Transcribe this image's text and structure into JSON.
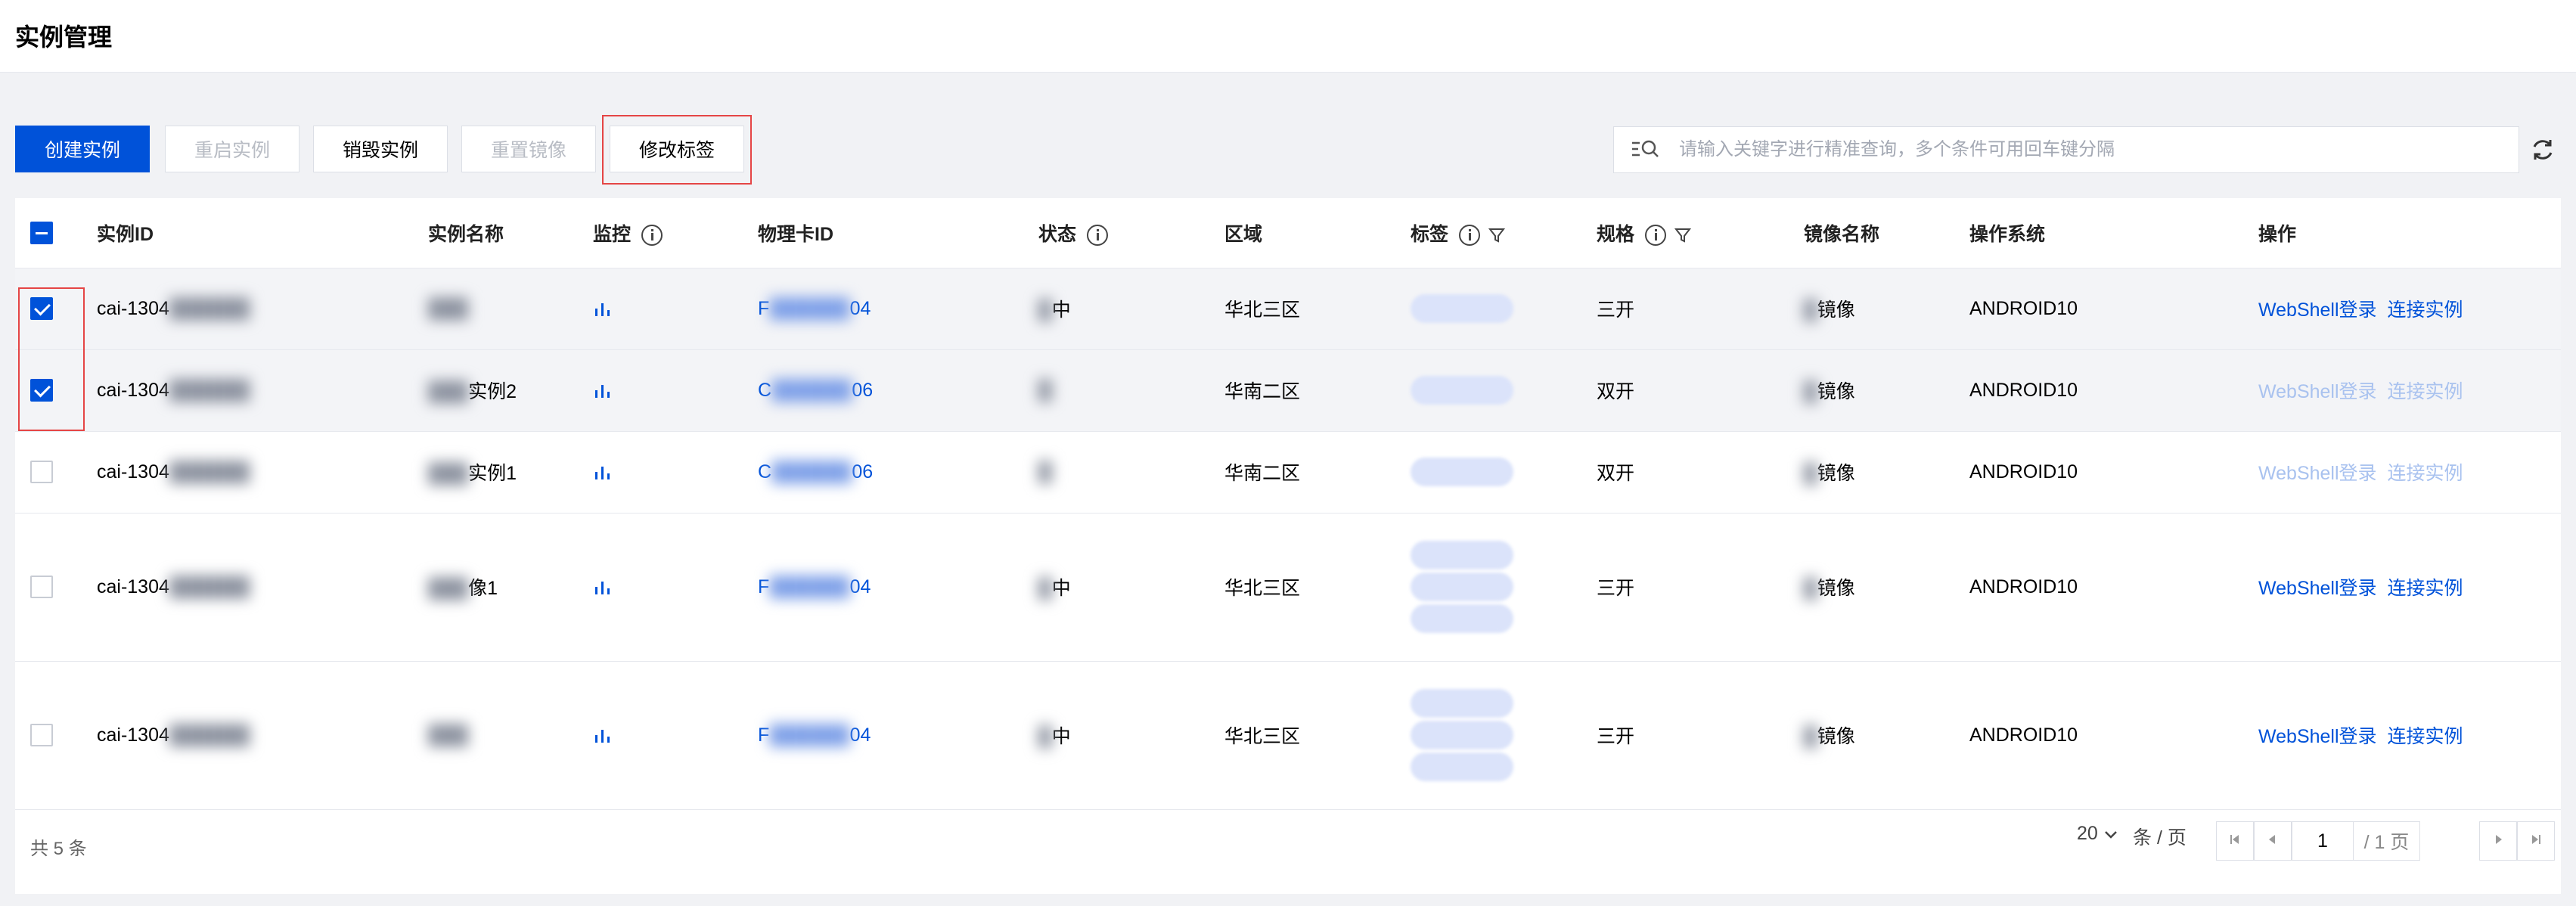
{
  "page": {
    "title": "实例管理"
  },
  "toolbar": {
    "create": "创建实例",
    "restart": "重启实例",
    "destroy": "销毁实例",
    "reset_image": "重置镜像",
    "modify_tags": "修改标签"
  },
  "search": {
    "placeholder": "请输入关键字进行精准查询，多个条件可用回车键分隔"
  },
  "table": {
    "headers": {
      "instance_id": "实例ID",
      "instance_name": "实例名称",
      "monitor": "监控",
      "card_id": "物理卡ID",
      "status": "状态",
      "region": "区域",
      "tags": "标签",
      "spec": "规格",
      "image_name": "镜像名称",
      "os": "操作系统",
      "actions": "操作"
    },
    "rows": [
      {
        "checked": true,
        "id": "cai-1304",
        "name": "",
        "card": "F",
        "card_tail": "04",
        "status": "中",
        "region": "华北三区",
        "spec": "三开",
        "image": "镜像",
        "os": "ANDROID10",
        "webshell": "WebShell登录",
        "connect": "连接实例",
        "enabled": true
      },
      {
        "checked": true,
        "id": "cai-1304",
        "name": "实例2",
        "card": "C",
        "card_tail": "06",
        "status": "",
        "region": "华南二区",
        "spec": "双开",
        "image": "镜像",
        "os": "ANDROID10",
        "webshell": "WebShell登录",
        "connect": "连接实例",
        "enabled": false
      },
      {
        "checked": false,
        "id": "cai-1304",
        "name": "实例1",
        "card": "C",
        "card_tail": "06",
        "status": "",
        "region": "华南二区",
        "spec": "双开",
        "image": "镜像",
        "os": "ANDROID10",
        "webshell": "WebShell登录",
        "connect": "连接实例",
        "enabled": false
      },
      {
        "checked": false,
        "id": "cai-1304",
        "name": "像1",
        "card": "F",
        "card_tail": "04",
        "status": "中",
        "region": "华北三区",
        "spec": "三开",
        "image": "镜像",
        "os": "ANDROID10",
        "webshell": "WebShell登录",
        "connect": "连接实例",
        "enabled": true
      },
      {
        "checked": false,
        "id": "cai-1304",
        "name": "",
        "card": "F",
        "card_tail": "04",
        "status": "中",
        "region": "华北三区",
        "spec": "三开",
        "image": "镜像",
        "os": "ANDROID10",
        "webshell": "WebShell登录",
        "connect": "连接实例",
        "enabled": true
      }
    ]
  },
  "footer": {
    "total": "共 5 条",
    "page_size": "20",
    "per_page_unit": "条 / 页",
    "current_page": "1",
    "total_pages": "/ 1 页"
  },
  "colors": {
    "primary": "#0052d9",
    "highlight": "#e54545",
    "disabled_link": "#a9c2ef"
  }
}
